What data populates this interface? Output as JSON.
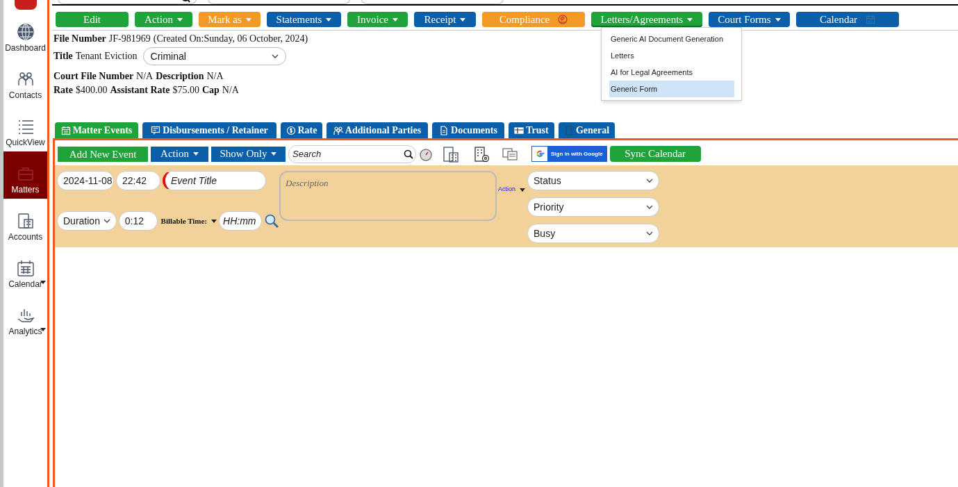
{
  "sidebar": {
    "items": [
      {
        "label": "Dashboard",
        "selected": false,
        "caret": false
      },
      {
        "label": "Contacts",
        "selected": false,
        "caret": false
      },
      {
        "label": "QuickView",
        "selected": false,
        "caret": false
      },
      {
        "label": "Matters",
        "selected": true,
        "caret": false
      },
      {
        "label": "Accounts",
        "selected": false,
        "caret": false
      },
      {
        "label": "Calendar",
        "selected": false,
        "caret": true
      },
      {
        "label": "Analytics",
        "selected": false,
        "caret": true
      }
    ]
  },
  "toolbar": [
    {
      "label": "Edit",
      "color": "#1fa33a",
      "caret": false
    },
    {
      "label": "Action",
      "color": "#1fa33a",
      "caret": true
    },
    {
      "label": "Mark as",
      "color": "#f39a26",
      "caret": true
    },
    {
      "label": "Statements",
      "color": "#0a5fa8",
      "caret": true
    },
    {
      "label": "Invoice",
      "color": "#1fa33a",
      "caret": true
    },
    {
      "label": "Receipt",
      "color": "#0a5fa8",
      "caret": true
    },
    {
      "label": "Compliance",
      "color": "#f39a26",
      "caret": false
    },
    {
      "label": "Letters/Agreements",
      "color": "#1fa33a",
      "caret": true,
      "expanded": true,
      "menu": [
        {
          "label": "Generic AI Document Generation",
          "selected": false
        },
        {
          "label": "Letters",
          "selected": false
        },
        {
          "label": "AI for Legal Agreements",
          "selected": false
        },
        {
          "label": "Generic Form",
          "selected": true
        }
      ]
    },
    {
      "label": "Court Forms",
      "color": "#0a5fa8",
      "caret": true
    },
    {
      "label": "Calendar",
      "color": "#0a5fa8",
      "caret": false
    }
  ],
  "matter": {
    "file_number_label": "File Number",
    "file_number": "JF-981969",
    "created": "(Created On:Sunday, 06 October, 2024)",
    "title_label": "Title",
    "title": "Tenant Eviction",
    "category": "Criminal",
    "court_file_label": "Court File Number",
    "court_file": "N/A",
    "description_label": "Description",
    "description": "N/A",
    "rate_label": "Rate",
    "rate": "$400.00",
    "assistant_rate_label": "Assistant Rate",
    "assistant_rate": "$75.00",
    "cap_label": "Cap",
    "cap": "N/A"
  },
  "tabs": [
    {
      "label": "Matter Events",
      "selected": true
    },
    {
      "label": "Disbursements / Retainer",
      "selected": false
    },
    {
      "label": "Rate",
      "selected": false
    },
    {
      "label": "Additional Parties",
      "selected": false
    },
    {
      "label": "Documents",
      "selected": false
    },
    {
      "label": "Trust",
      "selected": false
    },
    {
      "label": "General",
      "selected": false
    }
  ],
  "events_toolbar": {
    "add_button": "Add New Event",
    "action_button": "Action",
    "show_only_button": "Show Only",
    "search_placeholder": "Search",
    "google_button": "Sign in with Google",
    "sync_button": "Sync Calendar"
  },
  "event_form": {
    "date": "2024-11-08",
    "time": "22:42",
    "title_placeholder": "Event Title",
    "title_required": true,
    "description_placeholder": "Description",
    "action_link": "Action",
    "status": "Status",
    "priority": "Priority",
    "busy": "Busy",
    "duration": "Duration",
    "duration_value": "0:12",
    "billable_label": "Billable Time:",
    "billable_placeholder": "HH:mm"
  }
}
